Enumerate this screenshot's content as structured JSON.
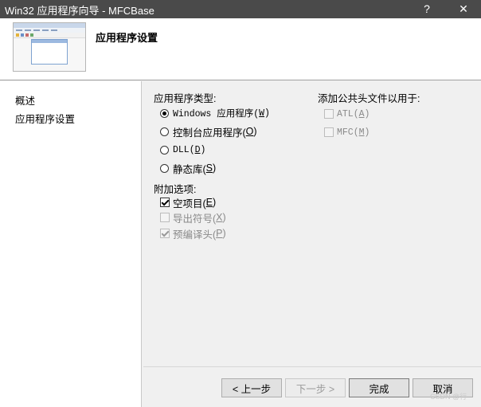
{
  "window": {
    "title": "Win32 应用程序向导 - MFCBase",
    "help_label": "?",
    "close_label": "✕"
  },
  "header": {
    "title": "应用程序设置",
    "thumbnail_icon": "app-window-preview-icon"
  },
  "sidebar": {
    "items": [
      {
        "label": "概述"
      },
      {
        "label": "应用程序设置"
      }
    ]
  },
  "app_type": {
    "label": "应用程序类型:",
    "options": [
      {
        "text": "Windows 应用程序(",
        "key": "W",
        "end": ")",
        "selected": true
      },
      {
        "text": "控制台应用程序(",
        "key": "O",
        "end": ")",
        "selected": false
      },
      {
        "text": "DLL(",
        "key": "D",
        "end": ")",
        "selected": false
      },
      {
        "text": "静态库(",
        "key": "S",
        "end": ")",
        "selected": false
      }
    ]
  },
  "extra_options": {
    "label": "附加选项:",
    "items": [
      {
        "text": "空项目(",
        "key": "E",
        "end": ")",
        "checked": true,
        "enabled": true
      },
      {
        "text": "导出符号(",
        "key": "X",
        "end": ")",
        "checked": false,
        "enabled": false
      },
      {
        "text": "预编译头(",
        "key": "P",
        "end": ")",
        "checked": true,
        "enabled": false
      }
    ]
  },
  "common_headers": {
    "label": "添加公共头文件以用于:",
    "items": [
      {
        "text": "ATL(",
        "key": "A",
        "end": ")",
        "checked": false,
        "enabled": false
      },
      {
        "text": "MFC(",
        "key": "M",
        "end": ")",
        "checked": false,
        "enabled": false
      }
    ]
  },
  "buttons": {
    "prev": "< 上一步",
    "next": "下一步 >",
    "finish": "完成",
    "cancel": "取消"
  },
  "watermark": "CSDN @行"
}
